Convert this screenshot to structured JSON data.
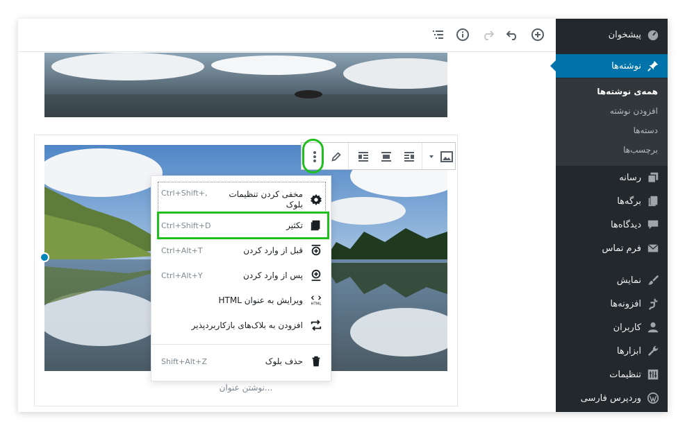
{
  "toolbar": {
    "icons": [
      "plus-circle-icon",
      "undo-icon",
      "redo-icon",
      "info-icon",
      "list-view-icon"
    ]
  },
  "sidebar": {
    "dashboard": "پیشخوان",
    "posts": "نوشته‌ها",
    "sub": [
      "همه‌ی نوشته‌ها",
      "افزودن نوشته",
      "دسته‌ها",
      "برچسب‌ها"
    ],
    "media": "رسانه",
    "pages": "برگه‌ها",
    "comments": "دیدگاه‌ها",
    "contact": "فرم تماس",
    "appearance": "نمایش",
    "plugins": "افزونه‌ها",
    "users": "کاربران",
    "tools": "ابزارها",
    "settings": "تنظیمات",
    "persian": "وردپرس فارسی"
  },
  "menu": {
    "hide_settings": "مخفی کردن تنظیمات بلوک",
    "hide_settings_sc": "Ctrl+Shift+,",
    "duplicate": "تکثیر",
    "duplicate_sc": "Ctrl+Shift+D",
    "insert_before": "قبل از وارد کردن",
    "insert_before_sc": "Ctrl+Alt+T",
    "insert_after": "پس از وارد کردن",
    "insert_after_sc": "Ctrl+Alt+Y",
    "edit_html": "ویرایش به عنوان HTML",
    "add_reusable": "افزودن به بلاک‌های بازکاربردپذیر",
    "remove": "حذف بلوک",
    "remove_sc": "Shift+Alt+Z"
  },
  "content": {
    "caption_placeholder": "نوشتن عنوان..."
  },
  "colors": {
    "sidebar_bg": "#23282d",
    "active_blue": "#0073aa",
    "highlight_green": "#1fbf1f"
  }
}
